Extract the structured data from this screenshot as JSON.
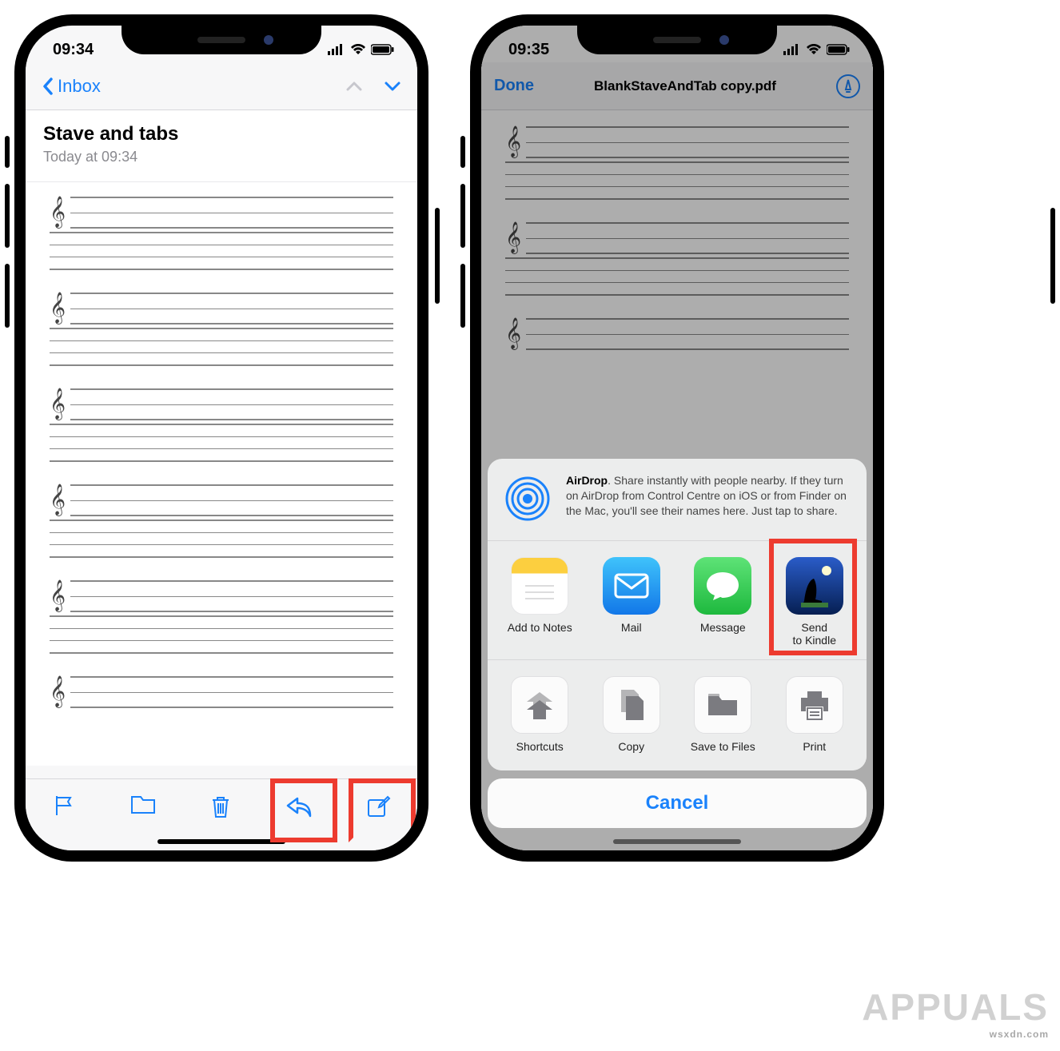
{
  "phone1": {
    "status": {
      "time": "09:34"
    },
    "nav": {
      "back_label": "Inbox"
    },
    "mail": {
      "subject": "Stave and tabs",
      "timestamp": "Today at 09:34"
    },
    "toolbar": {
      "flag": "flag-icon",
      "folder": "folder-icon",
      "trash": "trash-icon",
      "reply": "reply-icon",
      "compose": "compose-icon"
    }
  },
  "phone2": {
    "status": {
      "time": "09:35"
    },
    "nav": {
      "done_label": "Done",
      "filename": "BlankStaveAndTab copy.pdf"
    },
    "share": {
      "airdrop": {
        "title": "AirDrop",
        "body": ". Share instantly with people nearby. If they turn on AirDrop from Control Centre on iOS or from Finder on the Mac, you'll see their names here. Just tap to share."
      },
      "apps": [
        {
          "id": "notes",
          "label": "Add to Notes",
          "bg": "#fff",
          "accent": "#fccf3f"
        },
        {
          "id": "mail",
          "label": "Mail",
          "bg": "#1fa8f6",
          "accent": "#fff"
        },
        {
          "id": "message",
          "label": "Message",
          "bg": "#39d159",
          "accent": "#fff"
        },
        {
          "id": "kindle",
          "label": "Send\nto Kindle",
          "bg": "#08327a",
          "accent": "#000"
        }
      ],
      "actions": [
        {
          "id": "shortcuts",
          "label": "Shortcuts"
        },
        {
          "id": "copy",
          "label": "Copy"
        },
        {
          "id": "savefiles",
          "label": "Save to Files"
        },
        {
          "id": "print",
          "label": "Print"
        }
      ],
      "cancel_label": "Cancel"
    }
  },
  "watermark": {
    "brand": "APPUALS",
    "url": "wsxdn.com"
  }
}
